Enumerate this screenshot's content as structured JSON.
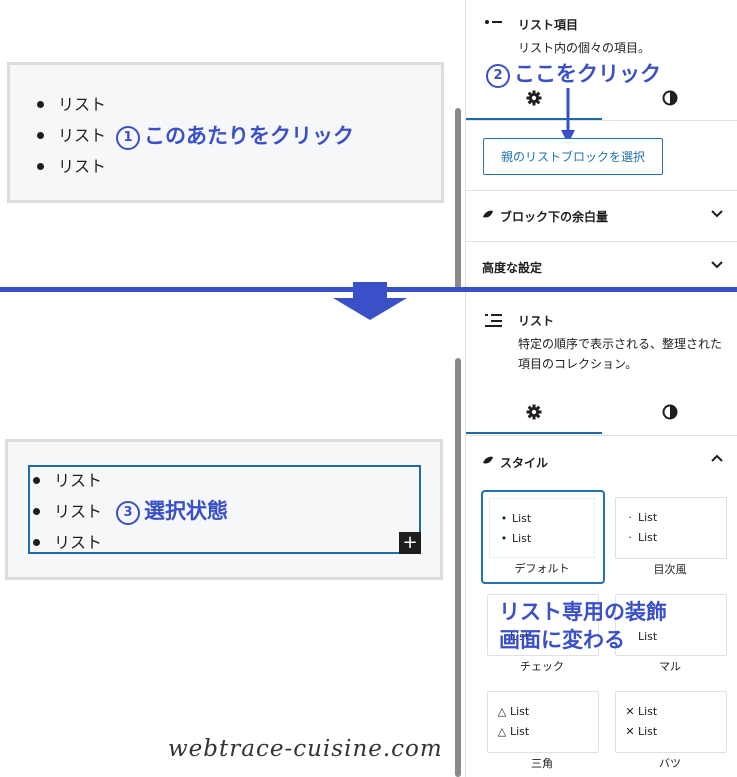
{
  "top_editor": {
    "items": [
      "リスト",
      "リスト",
      "リスト"
    ],
    "annotation_num": "1",
    "annotation_text": "このあたりをクリック"
  },
  "top_sidebar": {
    "block_title": "リスト項目",
    "block_desc": "リスト内の個々の項目。",
    "annotation_num": "2",
    "annotation_text": "ここをクリック",
    "select_parent_label": "親のリストブロックを選択",
    "panels": [
      {
        "label": "ブロック下の余白量",
        "icon": "swell-leaf-icon"
      },
      {
        "label": "高度な設定",
        "icon": ""
      }
    ]
  },
  "bottom_editor": {
    "items": [
      "リスト",
      "リスト",
      "リスト"
    ],
    "annotation_num": "3",
    "annotation_text": "選択状態",
    "add_button": "+"
  },
  "bottom_sidebar": {
    "block_title": "リスト",
    "block_desc": "特定の順序で表示される、整理された項目のコレクション。",
    "style_panel_label": "スタイル",
    "styles": [
      {
        "name": "デフォルト",
        "marker": "•",
        "items": [
          "List",
          "List"
        ],
        "selected": true
      },
      {
        "name": "目次風",
        "marker": "·",
        "items": [
          "List",
          "List"
        ],
        "selected": false
      },
      {
        "name": "チェック",
        "marker": "",
        "items": [
          "",
          "List"
        ],
        "selected": false
      },
      {
        "name": "マル",
        "marker": "",
        "items": [
          "",
          "List"
        ],
        "selected": false
      },
      {
        "name": "三角",
        "marker": "△",
        "items": [
          "List",
          "List"
        ],
        "selected": false
      },
      {
        "name": "バツ",
        "marker": "✕",
        "items": [
          "List",
          "List"
        ],
        "selected": false
      }
    ],
    "annotation_line1": "リスト専用の装飾",
    "annotation_line2": "画面に変わる"
  },
  "watermark": "webtrace-cuisine.com",
  "colors": {
    "accent": "#2271b1",
    "annotation": "#3a50c8"
  }
}
